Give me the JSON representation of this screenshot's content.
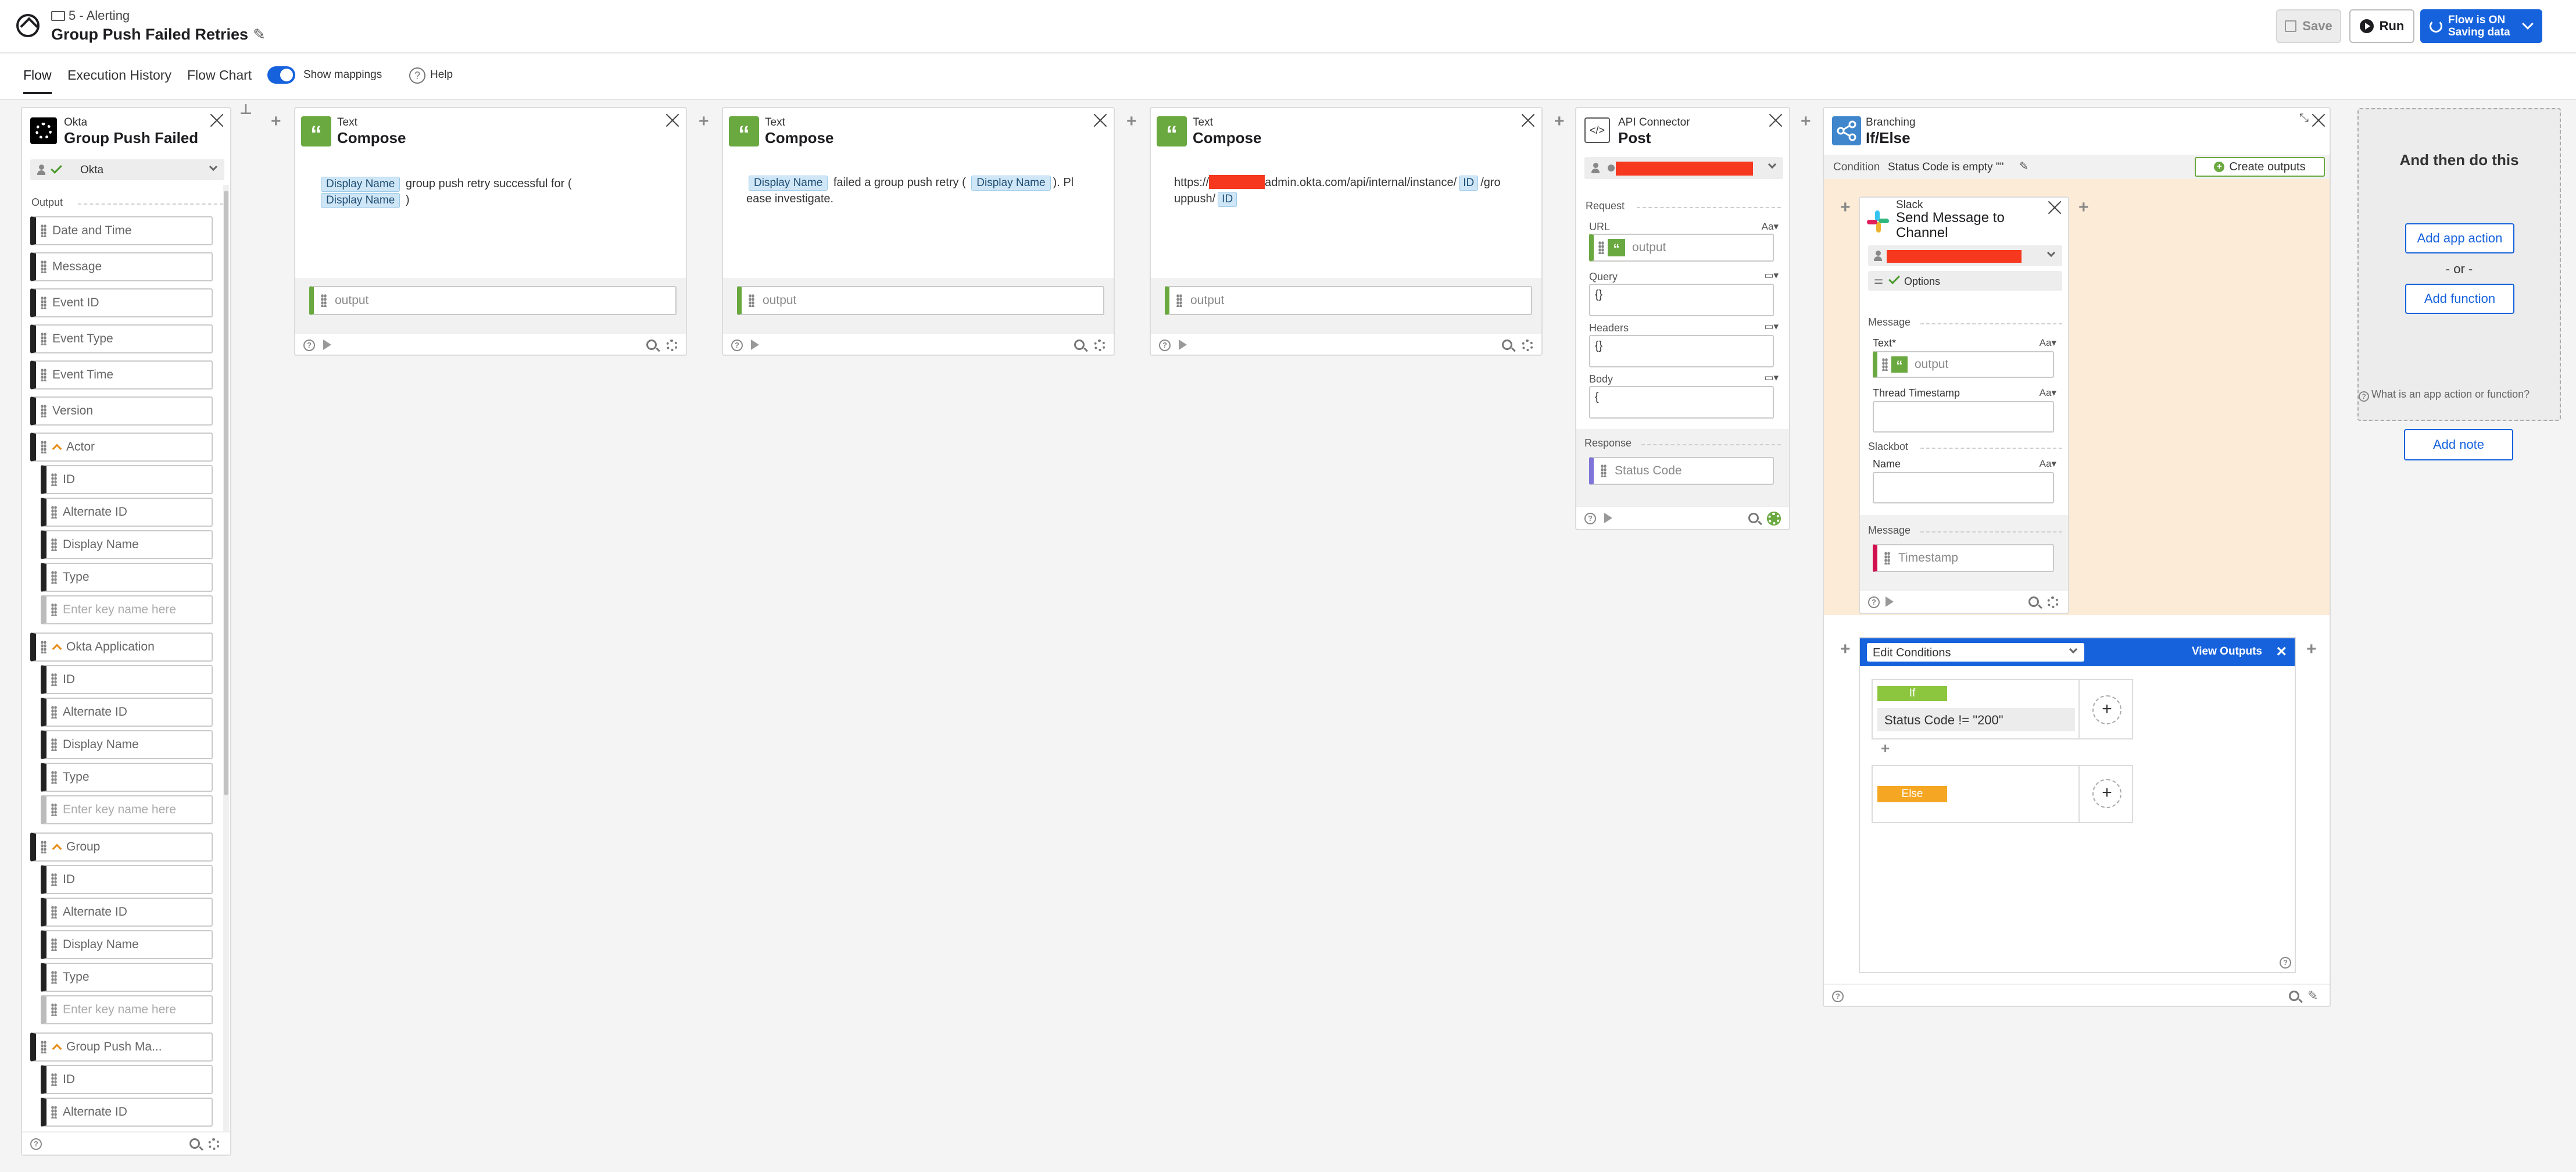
{
  "header": {
    "folder": "5 - Alerting",
    "title": "Group Push Failed Retries",
    "save_label": "Save",
    "run_label": "Run",
    "status_line1": "Flow is ON",
    "status_line2": "Saving data",
    "accent_color": "#1662dd"
  },
  "tabs": {
    "flow": "Flow",
    "execution_history": "Execution History",
    "flow_chart": "Flow Chart",
    "show_mappings": "Show mappings",
    "help": "Help"
  },
  "okta_card": {
    "app": "Okta",
    "title": "Group Push Failed",
    "connection": "Okta",
    "output_label": "Output",
    "fields": [
      "Date and Time",
      "Message",
      "Event ID",
      "Event Type",
      "Event Time",
      "Version"
    ],
    "actor": {
      "label": "Actor",
      "fields": [
        "ID",
        "Alternate ID",
        "Display Name",
        "Type"
      ],
      "placeholder": "Enter key name here"
    },
    "app_group": {
      "label": "Okta Application",
      "fields": [
        "ID",
        "Alternate ID",
        "Display Name",
        "Type"
      ],
      "placeholder": "Enter key name here"
    },
    "group": {
      "label": "Group",
      "fields": [
        "ID",
        "Alternate ID",
        "Display Name",
        "Type"
      ],
      "placeholder": "Enter key name here"
    },
    "group_push": {
      "label": "Group Push Ma...",
      "fields": [
        "ID",
        "Alternate ID"
      ]
    }
  },
  "compose1": {
    "app": "Text",
    "title": "Compose",
    "pill1": "Display Name",
    "text1": "group push retry successful for (",
    "pill2": "Display Name",
    "text2": ")",
    "output": "output"
  },
  "compose2": {
    "app": "Text",
    "title": "Compose",
    "pill1": "Display Name",
    "text1": "failed a group push retry (",
    "pill2": "Display Name",
    "text2": "). Pl",
    "text3": "ease investigate.",
    "output": "output"
  },
  "compose3": {
    "app": "Text",
    "title": "Compose",
    "text1": "https://",
    "text2": "admin.okta.com/api/internal/instance/",
    "pill1": "ID",
    "text3": "/gro",
    "text4": "uppush/",
    "pill2": "ID",
    "output": "output"
  },
  "api_card": {
    "app": "API Connector",
    "title": "Post",
    "request_label": "Request",
    "url_label": "URL",
    "url_output": "output",
    "query_label": "Query",
    "query_value": "{}",
    "headers_label": "Headers",
    "headers_value": "{}",
    "body_label": "Body",
    "body_value": "{",
    "response_label": "Response",
    "status_code": "Status Code",
    "aa": "Aa"
  },
  "branch_card": {
    "app": "Branching",
    "title": "If/Else",
    "condition_label": "Condition",
    "condition_value": "Status Code is empty \"\"",
    "create_outputs": "Create outputs"
  },
  "slack_card": {
    "app": "Slack",
    "title": "Send Message to Channel",
    "options": "Options",
    "message_label": "Message",
    "text_label": "Text*",
    "text_output": "output",
    "thread_label": "Thread Timestamp",
    "slackbot_label": "Slackbot",
    "name_label": "Name",
    "message_out_label": "Message",
    "timestamp": "Timestamp",
    "aa": "Aa"
  },
  "conditions_card": {
    "dropdown": "Edit Conditions",
    "view_outputs": "View Outputs",
    "if_label": "If",
    "if_condition": "Status Code != \"200\"",
    "else_label": "Else"
  },
  "and_then": {
    "title": "And then do this",
    "add_app_action": "Add app action",
    "or": "- or -",
    "add_function": "Add function",
    "what_is": "What is an app action or function?",
    "add_note": "Add note"
  },
  "colors": {
    "okta_accent": "#1d1d21",
    "text_icon": "#6aa840",
    "branch_bg": "#fcebd6",
    "conditions_header": "#1662dd",
    "if": "#8cc63f",
    "else": "#f5a623"
  }
}
